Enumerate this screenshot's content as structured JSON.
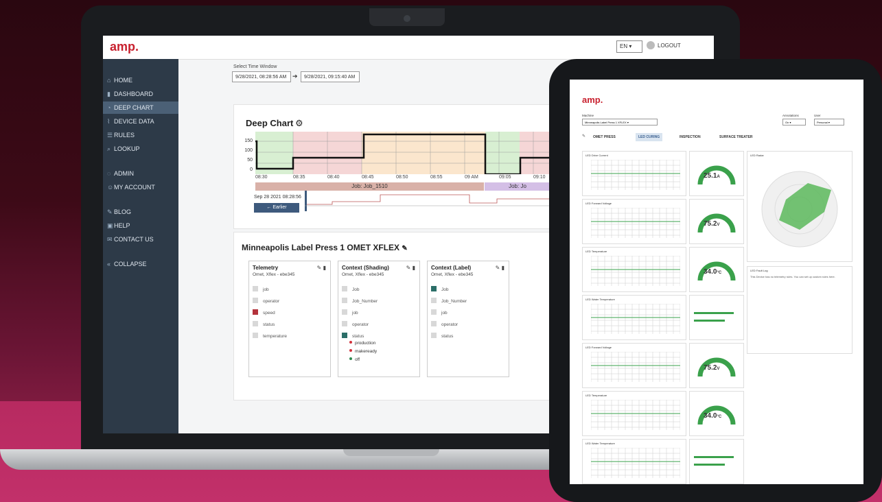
{
  "app": {
    "brand": "amp."
  },
  "header": {
    "language": "EN",
    "logout_label": "LOGOUT"
  },
  "sidebar": {
    "items": [
      {
        "label": "HOME",
        "icon": "home-icon"
      },
      {
        "label": "DASHBOARD",
        "icon": "bar-chart-icon"
      },
      {
        "label": "DEEP CHART",
        "icon": "deep-chart-icon"
      },
      {
        "label": "DEVICE DATA",
        "icon": "line-chart-icon"
      },
      {
        "label": "RULES",
        "icon": "list-icon"
      },
      {
        "label": "LOOKUP",
        "icon": "search-icon"
      },
      {
        "label": "ADMIN",
        "icon": "shield-icon"
      },
      {
        "label": "MY ACCOUNT",
        "icon": "user-icon"
      },
      {
        "label": "BLOG",
        "icon": "edit-icon"
      },
      {
        "label": "HELP",
        "icon": "help-icon"
      },
      {
        "label": "CONTACT US",
        "icon": "mail-icon"
      },
      {
        "label": "COLLAPSE",
        "icon": "chevron-left-icon"
      }
    ],
    "active": "DEEP CHART"
  },
  "time_window": {
    "label": "Select Time Window",
    "start": "9/28/2021, 08:28:56 AM",
    "end": "9/28/2021, 09:15:40 AM"
  },
  "deep_chart": {
    "title": "Deep Chart",
    "y_ticks": [
      "150",
      "100",
      "50",
      "0"
    ],
    "x_ticks": [
      "08:30",
      "08:35",
      "08:40",
      "08:45",
      "08:50",
      "08:55",
      "09 AM",
      "09:05",
      "09:10"
    ],
    "jobs": [
      "Job: Job_1510",
      "Job: Jo"
    ],
    "nav_date": "Sep 28 2021 08:28:56",
    "earlier_label": "← Earlier"
  },
  "device_section": {
    "title": "Minneapolis Label Press 1 OMET XFLEX",
    "cards": [
      {
        "title": "Telemetry",
        "subtitle": "Omet, Xflex - ebe345",
        "items": [
          {
            "label": "job",
            "checked": false
          },
          {
            "label": "operator",
            "checked": false
          },
          {
            "label": "speed",
            "checked": true
          },
          {
            "label": "status",
            "checked": false
          },
          {
            "label": "temperature",
            "checked": false
          }
        ]
      },
      {
        "title": "Context (Shading)",
        "subtitle": "Omet, Xflex - ebe345",
        "items": [
          {
            "label": "Job",
            "checked": false
          },
          {
            "label": "Job_Number",
            "checked": false
          },
          {
            "label": "job",
            "checked": false
          },
          {
            "label": "operator",
            "checked": false
          },
          {
            "label": "status",
            "checked": true
          }
        ],
        "legend": [
          {
            "label": "production",
            "color": "#d2323c"
          },
          {
            "label": "makeready",
            "color": "#d2323c"
          },
          {
            "label": "off",
            "color": "#2f8a4f"
          }
        ]
      },
      {
        "title": "Context (Label)",
        "subtitle": "Omet, Xflex - ebe345",
        "items": [
          {
            "label": "Job",
            "checked": true
          },
          {
            "label": "Job_Number",
            "checked": false
          },
          {
            "label": "job",
            "checked": false
          },
          {
            "label": "operator",
            "checked": false
          },
          {
            "label": "status",
            "checked": false
          }
        ]
      }
    ]
  },
  "tablet": {
    "brand": "amp.",
    "machine_label": "Machine",
    "machine_value": "Minneapolis Label Press 1 XFLEX",
    "annotations_label": "Annotations",
    "annotations_value": "On",
    "user_label": "User",
    "user_value": "Personal",
    "tabs": [
      "OMET PRESS",
      "LED CURING",
      "INSPECTION",
      "SURFACE TREATER"
    ],
    "active_tab": "LED CURING",
    "panels": [
      {
        "title": "LED Drive Current",
        "gauge": "25.1",
        "unit": "A"
      },
      {
        "title": "LED Forward Voltage",
        "gauge": "75.2",
        "unit": "V"
      },
      {
        "title": "LED Temperature",
        "gauge": "34.0",
        "unit": "°C"
      },
      {
        "title": "LED Water Temperature",
        "gauge": "",
        "unit": ""
      },
      {
        "title": "LED Forward Voltage",
        "gauge": "75.2",
        "unit": "V"
      },
      {
        "title": "LED Temperature",
        "gauge": "34.0",
        "unit": "°C"
      },
      {
        "title": "LED Water Temperature",
        "gauge": "",
        "unit": ""
      }
    ],
    "radar_title": "LED Radar",
    "fault_title": "LED Fault Log",
    "fault_text": "This Device has no telemetry rules. You can set up custom rules here."
  }
}
